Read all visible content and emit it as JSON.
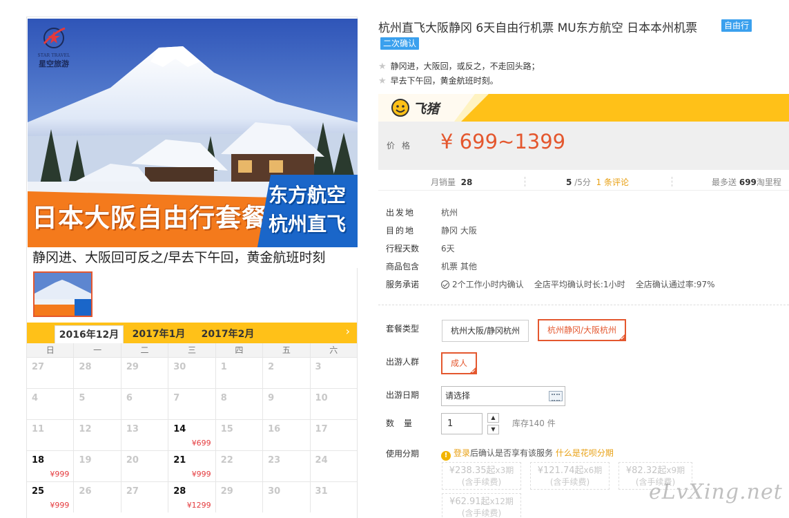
{
  "product": {
    "title": "杭州直飞大阪静冈 6天自由行机票 MU东方航空 日本本州机票",
    "tag_free": "自由行",
    "tag_confirm": "二次确认",
    "highlights": [
      "静冈进，大阪回，或反之，不走回头路；",
      "早去下午回，黄金航班时刻。"
    ]
  },
  "gallery": {
    "brand_en": "STAR TRAVEL",
    "brand_cn": "星空旅游",
    "banner_main": "日本大阪自由行套餐",
    "banner_side_1": "东方航空",
    "banner_side_2": "杭州直飞",
    "caption": "静冈进、大阪回可反之/早去下午回，黄金航班时刻"
  },
  "calendar": {
    "tabs": [
      "2016年12月",
      "2017年1月",
      "2017年2月"
    ],
    "next_icon": "chevron-right-icon",
    "weekdays": [
      "日",
      "一",
      "二",
      "三",
      "四",
      "五",
      "六"
    ],
    "weeks": [
      [
        {
          "d": "27"
        },
        {
          "d": "28"
        },
        {
          "d": "29"
        },
        {
          "d": "30"
        },
        {
          "d": "1"
        },
        {
          "d": "2"
        },
        {
          "d": "3"
        }
      ],
      [
        {
          "d": "4"
        },
        {
          "d": "5"
        },
        {
          "d": "6"
        },
        {
          "d": "7"
        },
        {
          "d": "8"
        },
        {
          "d": "9"
        },
        {
          "d": "10"
        }
      ],
      [
        {
          "d": "11"
        },
        {
          "d": "12"
        },
        {
          "d": "13"
        },
        {
          "d": "14",
          "p": "¥699",
          "a": true
        },
        {
          "d": "15"
        },
        {
          "d": "16"
        },
        {
          "d": "17"
        }
      ],
      [
        {
          "d": "18",
          "p": "¥999",
          "a": true
        },
        {
          "d": "19"
        },
        {
          "d": "20"
        },
        {
          "d": "21",
          "p": "¥999",
          "a": true
        },
        {
          "d": "22"
        },
        {
          "d": "23"
        },
        {
          "d": "24"
        }
      ],
      [
        {
          "d": "25",
          "p": "¥999",
          "a": true
        },
        {
          "d": "26"
        },
        {
          "d": "27"
        },
        {
          "d": "28",
          "p": "¥1299",
          "a": true
        },
        {
          "d": "29"
        },
        {
          "d": "30"
        },
        {
          "d": "31"
        }
      ]
    ]
  },
  "price": {
    "platform": "飞猪",
    "label": "价格",
    "value": "¥ 699~1399"
  },
  "stats": {
    "monthly_sales_label": "月销量",
    "monthly_sales": "28",
    "score": "5",
    "score_suffix": "/5分",
    "reviews": "1 条评论",
    "mileage_prefix": "最多送",
    "mileage": "699",
    "mileage_suffix": "淘里程"
  },
  "info": {
    "rows": [
      {
        "k": "出发地",
        "v": "杭州"
      },
      {
        "k": "目的地",
        "v": "静冈  大阪"
      },
      {
        "k": "行程天数",
        "v": "6天"
      },
      {
        "k": "商品包含",
        "v": "机票  其他"
      }
    ],
    "service_label": "服务承诺",
    "service_1": "2个工作小时内确认",
    "service_2": "全店平均确认时长:1小时",
    "service_3": "全店确认通过率:97%"
  },
  "options": {
    "package_label": "套餐类型",
    "package_1": "杭州大阪/静冈杭州",
    "package_2": "杭州静冈/大阪杭州",
    "traveler_label": "出游人群",
    "traveler_1": "成人",
    "date_label": "出游日期",
    "date_placeholder": "请选择",
    "qty_label": "数量",
    "qty_value": "1",
    "stock": "库存140 件",
    "installment_label": "使用分期",
    "installment_login": "登录",
    "installment_note": "后确认是否享有该服务",
    "installment_what": "什么是花呗分期",
    "plans": [
      {
        "amt": "¥238.35起",
        "n": "x3期",
        "fee": "(含手续费)"
      },
      {
        "amt": "¥121.74起",
        "n": "x6期",
        "fee": "(含手续费)"
      },
      {
        "amt": "¥82.32起",
        "n": "x9期",
        "fee": "(含手续费)"
      },
      {
        "amt": "¥62.91起",
        "n": "x12期",
        "fee": "(含手续费)"
      }
    ]
  },
  "watermark": "eLvXing.net",
  "colors": {
    "accent_orange": "#e4572e",
    "brand_yellow": "#ffc118",
    "tag_blue": "#3aa0ee"
  }
}
